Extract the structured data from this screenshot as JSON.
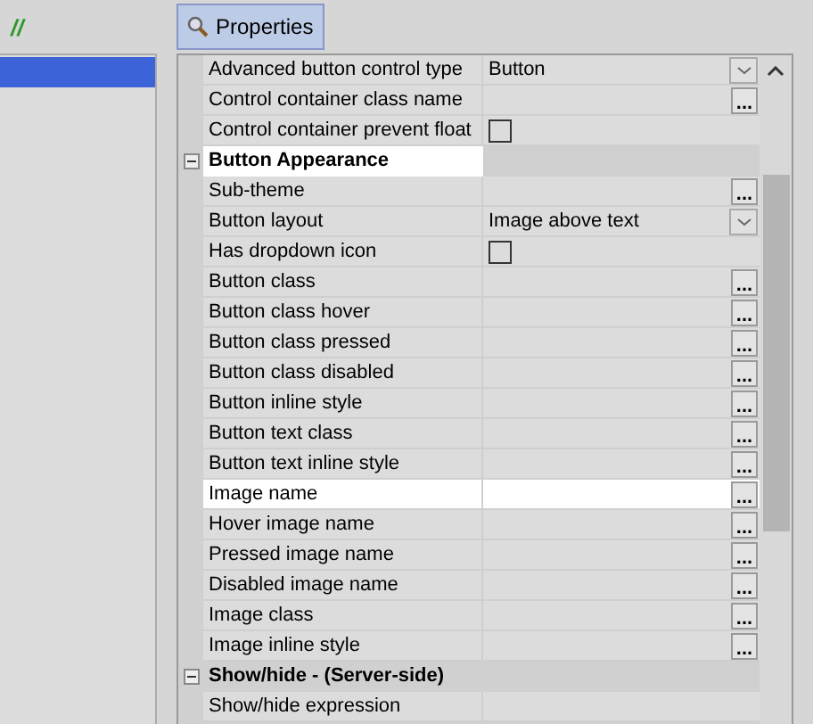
{
  "toolbar": {
    "mark": "//",
    "properties_button": {
      "label": "Properties",
      "pressed": true
    }
  },
  "left_list": {
    "items": [
      {
        "selected": true
      }
    ]
  },
  "property_grid": {
    "rows": [
      {
        "kind": "dropdown",
        "name": "Advanced button control type",
        "value": "Button",
        "selected": false
      },
      {
        "kind": "ellipsis",
        "name": "Control container class name",
        "selected": false
      },
      {
        "kind": "checkbox",
        "name": "Control container prevent float",
        "checked": false,
        "selected": false
      },
      {
        "kind": "category",
        "name": "Button Appearance",
        "expanded": true,
        "selected": true
      },
      {
        "kind": "ellipsis",
        "name": "Sub-theme",
        "selected": false
      },
      {
        "kind": "dropdown",
        "name": "Button layout",
        "value": "Image above text",
        "selected": false
      },
      {
        "kind": "checkbox",
        "name": "Has dropdown icon",
        "checked": false,
        "selected": false
      },
      {
        "kind": "ellipsis",
        "name": "Button class",
        "selected": false
      },
      {
        "kind": "ellipsis",
        "name": "Button class hover",
        "selected": false
      },
      {
        "kind": "ellipsis",
        "name": "Button class pressed",
        "selected": false
      },
      {
        "kind": "ellipsis",
        "name": "Button class disabled",
        "selected": false
      },
      {
        "kind": "ellipsis",
        "name": "Button inline style",
        "selected": false
      },
      {
        "kind": "ellipsis",
        "name": "Button text class",
        "selected": false
      },
      {
        "kind": "ellipsis",
        "name": "Button text inline style",
        "selected": false
      },
      {
        "kind": "ellipsis",
        "name": "Image name",
        "selected": true
      },
      {
        "kind": "ellipsis",
        "name": "Hover image name",
        "selected": false
      },
      {
        "kind": "ellipsis",
        "name": "Pressed image name",
        "selected": false
      },
      {
        "kind": "ellipsis",
        "name": "Disabled image name",
        "selected": false
      },
      {
        "kind": "ellipsis",
        "name": "Image class",
        "selected": false
      },
      {
        "kind": "ellipsis",
        "name": "Image inline style",
        "selected": false
      },
      {
        "kind": "category",
        "name": "Show/hide - (Server-side)",
        "expanded": true,
        "selected": false
      },
      {
        "kind": "text",
        "name": "Show/hide expression",
        "selected": false
      }
    ]
  },
  "ellipsis_label": "..."
}
